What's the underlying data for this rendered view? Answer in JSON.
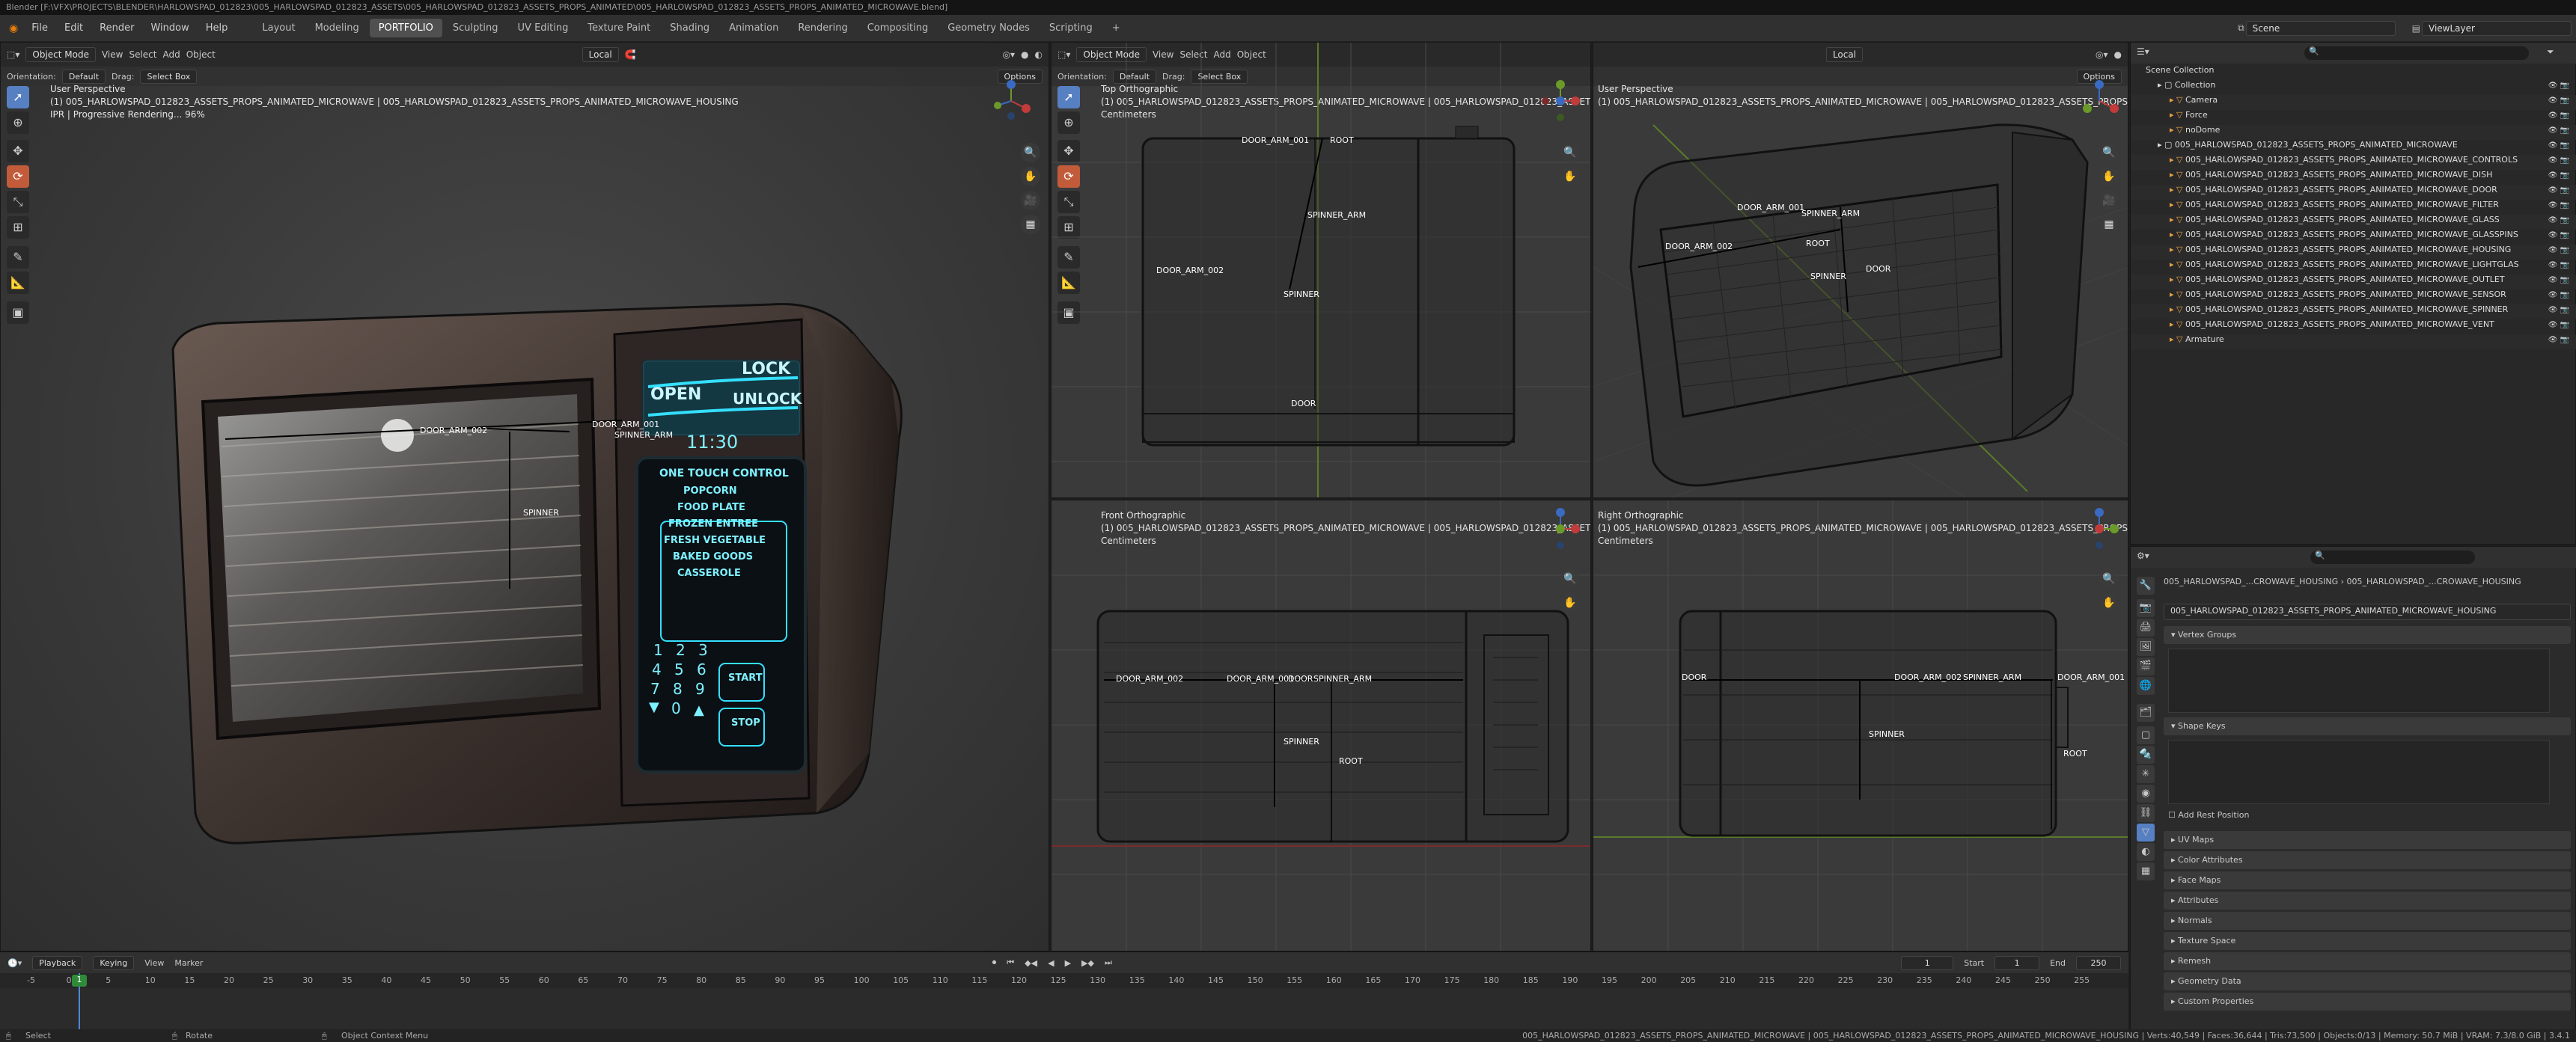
{
  "window": {
    "title": "Blender [F:\\VFX\\PROJECTS\\BLENDER\\HARLOWSPAD_012823\\005_HARLOWSPAD_012823_ASSETS\\005_HARLOWSPAD_012823_ASSETS_PROPS_ANIMATED\\005_HARLOWSPAD_012823_ASSETS_PROPS_ANIMATED_MICROWAVE.blend]"
  },
  "menus": [
    "File",
    "Edit",
    "Render",
    "Window",
    "Help"
  ],
  "workspaces": [
    "Layout",
    "Modeling",
    "PORTFOLIO",
    "Sculpting",
    "UV Editing",
    "Texture Paint",
    "Shading",
    "Animation",
    "Rendering",
    "Compositing",
    "Geometry Nodes",
    "Scripting"
  ],
  "active_workspace": "PORTFOLIO",
  "scene": {
    "name": "Scene",
    "view_layer": "ViewLayer"
  },
  "header": {
    "mode": "Object Mode",
    "view": "View",
    "select": "Select",
    "add": "Add",
    "object": "Object",
    "transform": "Local",
    "options": "Options",
    "orientation_label": "Orientation:",
    "orientation_value": "Default",
    "drag_label": "Drag:",
    "drag_value": "Select Box"
  },
  "viewports": {
    "main": {
      "title": "User Perspective",
      "object": "(1) 005_HARLOWSPAD_012823_ASSETS_PROPS_ANIMATED_MICROWAVE | 005_HARLOWSPAD_012823_ASSETS_PROPS_ANIMATED_MICROWAVE_HOUSING",
      "status": "IPR | Progressive Rendering... 96%"
    },
    "top": {
      "title": "Top Orthographic",
      "object": "(1) 005_HARLOWSPAD_012823_ASSETS_PROPS_ANIMATED_MICROWAVE | 005_HARLOWSPAD_012823_ASSETS_PROPS_ANIMAT",
      "units": "Centimeters"
    },
    "persp2": {
      "title": "User Perspective",
      "object": "(1) 005_HARLOWSPAD_012823_ASSETS_PROPS_ANIMATED_MICROWAVE | 005_HARLOWSPAD_012823_ASSETS_PROPS_ANIMATED_MICROWAVE_HOUSING"
    },
    "front": {
      "title": "Front Orthographic",
      "object": "(1) 005_HARLOWSPAD_012823_ASSETS_PROPS_ANIMATED_MICROWAVE | 005_HARLOWSPAD_012823_ASSETS_PROPS_ANIMAT",
      "units": "Centimeters"
    },
    "right": {
      "title": "Right Orthographic",
      "object": "(1) 005_HARLOWSPAD_012823_ASSETS_PROPS_ANIMATED_MICROWAVE | 005_HARLOWSPAD_012823_ASSETS_PROPS_ANIMATED_MICROWAVE_HOUSING",
      "units": "Centimeters"
    }
  },
  "bones": {
    "door_arm_001": "DOOR_ARM_001",
    "door_arm_002": "DOOR_ARM_002",
    "spinner_arm": "SPINNER_ARM",
    "spinner": "SPINNER",
    "root": "ROOT",
    "door": "DOOR"
  },
  "microwave": {
    "lock": "LOCK",
    "open": "OPEN",
    "unlock": "UNLOCK",
    "clock": "11:30",
    "panel_title": "ONE TOUCH CONTROL",
    "presets": [
      "POPCORN",
      "FOOD PLATE",
      "FROZEN ENTREE",
      "FRESH VEGETABLE",
      "BAKED GOODS",
      "CASSEROLE"
    ],
    "keys": [
      "1",
      "2",
      "3",
      "4",
      "5",
      "6",
      "7",
      "8",
      "9",
      "▼",
      "0",
      "▲"
    ],
    "start": "START",
    "stop": "STOP"
  },
  "outliner": {
    "root": "Scene Collection",
    "items": [
      {
        "label": "Collection",
        "depth": 1
      },
      {
        "label": "Camera",
        "depth": 2
      },
      {
        "label": "Force",
        "depth": 2
      },
      {
        "label": "noDome",
        "depth": 2
      },
      {
        "label": "005_HARLOWSPAD_012823_ASSETS_PROPS_ANIMATED_MICROWAVE",
        "depth": 1
      },
      {
        "label": "005_HARLOWSPAD_012823_ASSETS_PROPS_ANIMATED_MICROWAVE_CONTROLS",
        "depth": 2
      },
      {
        "label": "005_HARLOWSPAD_012823_ASSETS_PROPS_ANIMATED_MICROWAVE_DISH",
        "depth": 2
      },
      {
        "label": "005_HARLOWSPAD_012823_ASSETS_PROPS_ANIMATED_MICROWAVE_DOOR",
        "depth": 2
      },
      {
        "label": "005_HARLOWSPAD_012823_ASSETS_PROPS_ANIMATED_MICROWAVE_FILTER",
        "depth": 2
      },
      {
        "label": "005_HARLOWSPAD_012823_ASSETS_PROPS_ANIMATED_MICROWAVE_GLASS",
        "depth": 2
      },
      {
        "label": "005_HARLOWSPAD_012823_ASSETS_PROPS_ANIMATED_MICROWAVE_GLASSPINS",
        "depth": 2
      },
      {
        "label": "005_HARLOWSPAD_012823_ASSETS_PROPS_ANIMATED_MICROWAVE_HOUSING",
        "depth": 2
      },
      {
        "label": "005_HARLOWSPAD_012823_ASSETS_PROPS_ANIMATED_MICROWAVE_LIGHTGLAS",
        "depth": 2
      },
      {
        "label": "005_HARLOWSPAD_012823_ASSETS_PROPS_ANIMATED_MICROWAVE_OUTLET",
        "depth": 2
      },
      {
        "label": "005_HARLOWSPAD_012823_ASSETS_PROPS_ANIMATED_MICROWAVE_SENSOR",
        "depth": 2
      },
      {
        "label": "005_HARLOWSPAD_012823_ASSETS_PROPS_ANIMATED_MICROWAVE_SPINNER",
        "depth": 2
      },
      {
        "label": "005_HARLOWSPAD_012823_ASSETS_PROPS_ANIMATED_MICROWAVE_VENT",
        "depth": 2
      },
      {
        "label": "Armature",
        "depth": 2
      }
    ]
  },
  "properties": {
    "breadcrumb_a": "005_HARLOWSPAD_...CROWAVE_HOUSING",
    "breadcrumb_b": "005_HARLOWSPAD_...CROWAVE_HOUSING",
    "mesh_name": "005_HARLOWSPAD_012823_ASSETS_PROPS_ANIMATED_MICROWAVE_HOUSING",
    "vertex_groups": "Vertex Groups",
    "shape_keys": "Shape Keys",
    "add_rest": "Add Rest Position",
    "panels": [
      "UV Maps",
      "Color Attributes",
      "Face Maps",
      "Attributes",
      "Normals",
      "Texture Space",
      "Remesh",
      "Geometry Data",
      "Custom Properties"
    ]
  },
  "timeline": {
    "playback": "Playback",
    "keying": "Keying",
    "view": "View",
    "marker": "Marker",
    "current": "1",
    "start_label": "Start",
    "start": "1",
    "end_label": "End",
    "end": "250",
    "ticks": [
      "-5",
      "0",
      "5",
      "10",
      "15",
      "20",
      "25",
      "30",
      "35",
      "40",
      "45",
      "50",
      "55",
      "60",
      "65",
      "70",
      "75",
      "80",
      "85",
      "90",
      "95",
      "100",
      "105",
      "110",
      "115",
      "120",
      "125",
      "130",
      "135",
      "140",
      "145",
      "150",
      "155",
      "160",
      "165",
      "170",
      "175",
      "180",
      "185",
      "190",
      "195",
      "200",
      "205",
      "210",
      "215",
      "220",
      "225",
      "230",
      "235",
      "240",
      "245",
      "250",
      "255"
    ]
  },
  "status": {
    "left": "Select",
    "mid": "Rotate",
    "ctx": "Object Context Menu",
    "right": "005_HARLOWSPAD_012823_ASSETS_PROPS_ANIMATED_MICROWAVE | 005_HARLOWSPAD_012823_ASSETS_PROPS_ANIMATED_MICROWAVE_HOUSING | Verts:40,549 | Faces:36,644 | Tris:73,500 | Objects:0/13 | Memory: 50.7 MiB | VRAM: 7.3/8.0 GiB | 3.4.1"
  },
  "colors": {
    "accent": "#5680c2",
    "active_tool": "#c25b3a",
    "screen_cyan": "#34e0ff",
    "keyframe": "#2f8a3a"
  }
}
